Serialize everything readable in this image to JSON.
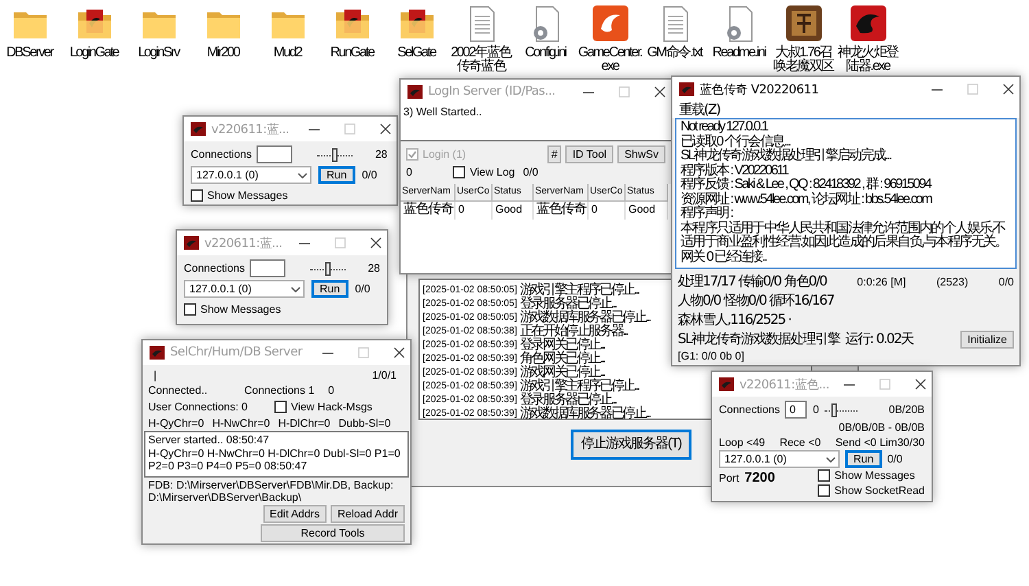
{
  "desktop_icons": [
    {
      "label": "DBServer",
      "kind": "folder"
    },
    {
      "label": "LoginGate",
      "kind": "red-folder"
    },
    {
      "label": "LoginSrv",
      "kind": "folder"
    },
    {
      "label": "Mir200",
      "kind": "folder"
    },
    {
      "label": "Mud2",
      "kind": "folder"
    },
    {
      "label": "RunGate",
      "kind": "red-folder"
    },
    {
      "label": "SelGate",
      "kind": "red-folder"
    },
    {
      "label": "2002年蓝色传奇蓝色",
      "kind": "text-file"
    },
    {
      "label": "Config.ini",
      "kind": "config-file"
    },
    {
      "label": "GameCenter.exe",
      "kind": "orange-app"
    },
    {
      "label": "GM命令.txt",
      "kind": "text-file"
    },
    {
      "label": "Readme.ini",
      "kind": "config-file"
    },
    {
      "label": "大叔1.76召唤老魔双区",
      "kind": "brown-app"
    },
    {
      "label": "神龙火炬登陆器.exe",
      "kind": "red-app"
    }
  ],
  "game_center": {
    "log": [
      {
        "time": "[2025-01-02 08:50:05]",
        "message": "游戏引擎主程序已停止..."
      },
      {
        "time": "[2025-01-02 08:50:05]",
        "message": "登录服务器已停止..."
      },
      {
        "time": "[2025-01-02 08:50:05]",
        "message": "游戏数据库服务器已停止..."
      },
      {
        "time": "[2025-01-02 08:50:38]",
        "message": "正在开始停止服务器..."
      },
      {
        "time": "[2025-01-02 08:50:39]",
        "message": "登录网关已停止..."
      },
      {
        "time": "[2025-01-02 08:50:39]",
        "message": "角色网关已停止..."
      },
      {
        "time": "[2025-01-02 08:50:39]",
        "message": "游戏网关已停止..."
      },
      {
        "time": "[2025-01-02 08:50:39]",
        "message": "游戏引擎主程序已停止..."
      },
      {
        "time": "[2025-01-02 08:50:39]",
        "message": "登录服务器已停止..."
      },
      {
        "time": "[2025-01-02 08:50:39]",
        "message": "游戏数据库服务器已停止..."
      }
    ],
    "stop_button": "停止游戏服务器(T)"
  },
  "gate_windows": [
    {
      "title": "v220611:蓝...",
      "active": false,
      "connections_label": "Connections",
      "slider": {
        "level": 0.5
      },
      "slider_value": "28",
      "address": "127.0.0.1 (0)",
      "run_button": "Run",
      "traffic": "0/0",
      "show_messages": {
        "label": "Show Messages",
        "checked": false
      }
    },
    {
      "title": "v220611:蓝...",
      "active": false,
      "connections_label": "Connections",
      "slider": {
        "level": 0.5
      },
      "slider_value": "28",
      "address": "127.0.0.1 (0)",
      "run_button": "Run",
      "traffic": "0/0",
      "show_messages": {
        "label": "Show Messages",
        "checked": false
      }
    }
  ],
  "login_server": {
    "title": "LogIn Server (ID/Pas...",
    "active": false,
    "log": [
      "3) Well Started.."
    ],
    "login_check": {
      "label": "Login (1)",
      "checked": true,
      "disabled": true
    },
    "buttons": [
      "#",
      "ID Tool",
      "ShwSv"
    ],
    "count": "0",
    "view_log": {
      "label": "View Log",
      "checked": false
    },
    "traffic": "0/0",
    "grid": {
      "columns": [
        "ServerNam",
        "UserCo",
        "Status",
        "ServerNam",
        "UserCo",
        "Status"
      ],
      "rows": [
        [
          "蓝色传奇",
          "0",
          "Good",
          "蓝色传奇",
          "0",
          "Good"
        ]
      ]
    }
  },
  "engine": {
    "title": "蓝色传奇  V20220611",
    "active": true,
    "menu": [
      "重载(Z)"
    ],
    "log": [
      "Not ready 127.0.0.1",
      "已读取0 个行会信息...",
      "SL神龙传奇游戏数据处理引擎启动完成...",
      "程序版本 : V20220611",
      "程序反馈 : Saki & Lee , QQ : 82418392 , 群 : 96915094",
      "资源网址 : www.54lee.com, 论坛网址 : bbs.54lee.com",
      "程序声明 :",
      "本程序只适用于中华人民共和国法律允许范围内的个人娱乐,不适用于商业盈利性经营.如因此造成的后果自负,与本程序无关。",
      "网关 0 已经连接.."
    ],
    "status": {
      "line_1": [
        "处理17/17 传输0/0 角色0/0",
        "0:0:26 [M]",
        "(2523)",
        "0/0"
      ],
      "line_2": "人物0/0 怪物0/0 循环16/167",
      "line_3": "森林雪人,116/2525 ·",
      "engine_name": "SL神龙传奇游戏数据处理引擎",
      "uptime": "运行: 0.02天",
      "line_5": "[G1: 0/0 0b 0]"
    },
    "initialize_button": "Initialize"
  },
  "selchr": {
    "title": "SelChr/Hum/DB Server",
    "active": false,
    "marker": "|",
    "ratio": "1/0/1",
    "connected": "Connected..",
    "connections": "Connections 1",
    "count": "0",
    "user_connections": "User Connections: 0",
    "view_hack": {
      "label": "View Hack-Msgs",
      "checked": false
    },
    "counters": [
      "H-QyChr=0",
      "H-NwChr=0",
      "H-DlChr=0",
      "Dubb-Sl=0"
    ],
    "log": [
      "Server started.. 08:50:47",
      "H-QyChr=0 H-NwChr=0 H-DlChr=0 Dubl-Sl=0 P1=0 P2=0 P3=0 P4=0 P5=0 08:50:47"
    ],
    "paths": "FDB: D:\\Mirserver\\DBServer\\FDB\\Mir.DB,  Backup: D:\\Mirserver\\DBServer\\Backup\\",
    "buttons": [
      "Edit Addrs",
      "Reload Addr"
    ],
    "record_button": "Record Tools"
  },
  "gate_large": {
    "title": "v220611:蓝色...",
    "active": false,
    "connections_label": "Connections",
    "connections": "0",
    "count": "0",
    "slider": {
      "level": 0.3
    },
    "bytes": "0B/20B",
    "bytes_detail": "0B/0B/0B - 0B/0B",
    "loop": "Loop <49",
    "rece": "Rece <0",
    "send": "Send <0 Lim30/30",
    "address": "127.0.0.1 (0)",
    "run_button": "Run",
    "traffic": "0/0",
    "port_label": "Port",
    "port": "7200",
    "checks": [
      {
        "label": "Show Messages",
        "checked": false
      },
      {
        "label": "Show SocketRead",
        "checked": false
      }
    ]
  }
}
